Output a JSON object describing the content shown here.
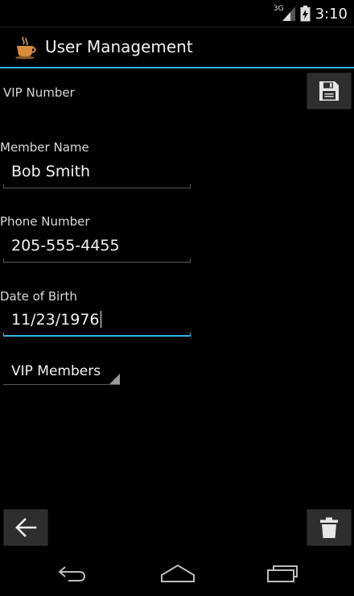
{
  "status_bar": {
    "network_type": "3G",
    "time": "3:10"
  },
  "action_bar": {
    "title": "User Management",
    "app_icon": "coffee-cup-icon"
  },
  "form": {
    "vip_number": {
      "label": "VIP Number"
    },
    "member_name": {
      "label": "Member Name",
      "value": "Bob Smith"
    },
    "phone_number": {
      "label": "Phone Number",
      "value": "205-555-4455"
    },
    "date_of_birth": {
      "label": "Date of Birth",
      "value": "11/23/1976"
    },
    "membership": {
      "selected": "VIP Members"
    }
  },
  "buttons": {
    "save": "floppy-disk-icon",
    "back": "arrow-left-icon",
    "delete": "trash-icon"
  },
  "navigation": {
    "back": "nav-back-icon",
    "home": "nav-home-icon",
    "recents": "nav-recents-icon"
  },
  "colors": {
    "accent": "#33b5e5",
    "background": "#000000",
    "button": "#2e2e2e"
  }
}
